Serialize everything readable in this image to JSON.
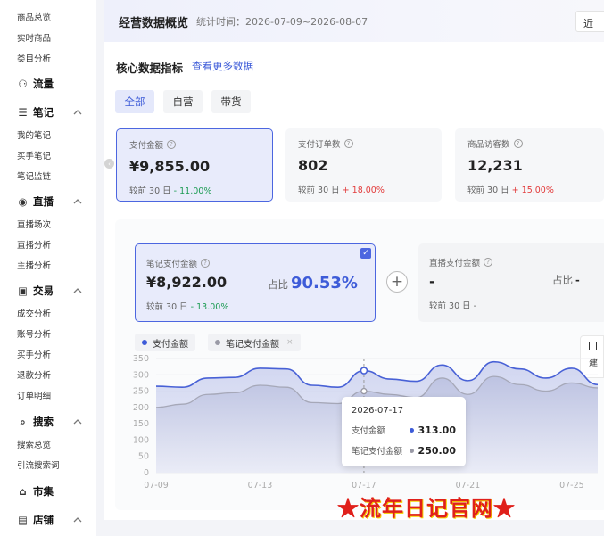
{
  "sidebar": {
    "items_top": [
      "商品总览",
      "实时商品",
      "类目分析"
    ],
    "groups": [
      {
        "label": "流量",
        "icon": "traffic-icon",
        "items": []
      },
      {
        "label": "笔记",
        "icon": "note-icon",
        "items": [
          "我的笔记",
          "买手笔记",
          "笔记监链"
        ]
      },
      {
        "label": "直播",
        "icon": "live-icon",
        "items": [
          "直播场次",
          "直播分析",
          "主播分析"
        ]
      },
      {
        "label": "交易",
        "icon": "trade-icon",
        "items": [
          "成交分析",
          "账号分析",
          "买手分析",
          "退款分析",
          "订单明细"
        ]
      },
      {
        "label": "搜索",
        "icon": "search-icon",
        "items": [
          "搜索总览",
          "引流搜索词"
        ]
      },
      {
        "label": "市集",
        "icon": "market-icon",
        "items": []
      },
      {
        "label": "店铺",
        "icon": "shop-icon",
        "items": []
      }
    ]
  },
  "header": {
    "title": "经营数据概览",
    "stat_time": "统计时间：2026-07-09~2026-08-07",
    "recent_label": "近"
  },
  "section": {
    "title": "核心数据指标",
    "more_link": "查看更多数据"
  },
  "tabs": [
    {
      "label": "全部",
      "active": true
    },
    {
      "label": "自营",
      "active": false
    },
    {
      "label": "带货",
      "active": false
    }
  ],
  "metrics": [
    {
      "label": "支付金额",
      "value": "¥9,855.00",
      "compare_prefix": "较前 30 日",
      "change": "- 11.00%",
      "trend": "down",
      "selected": true
    },
    {
      "label": "支付订单数",
      "value": "802",
      "compare_prefix": "较前 30 日",
      "change": "+ 18.00%",
      "trend": "up",
      "selected": false
    },
    {
      "label": "商品访客数",
      "value": "12,231",
      "compare_prefix": "较前 30 日",
      "change": "+ 15.00%",
      "trend": "up",
      "selected": false
    }
  ],
  "sub_metrics": [
    {
      "label": "笔记支付金额",
      "value": "¥8,922.00",
      "share_label": "占比",
      "share": "90.53%",
      "compare_prefix": "较前 30 日",
      "change": "- 13.00%"
    },
    {
      "label": "直播支付金额",
      "value": "-",
      "share_label": "占比",
      "share": "-",
      "compare_prefix": "较前 30 日",
      "change": "-"
    }
  ],
  "legend": [
    {
      "name": "支付金额",
      "color": "#3d5bd8"
    },
    {
      "name": "笔记支付金额",
      "color": "#9a9aa6",
      "close": "×"
    }
  ],
  "side_tool_label": "建",
  "tooltip": {
    "date": "2026-07-17",
    "rows": [
      {
        "name": "支付金额",
        "value": "313.00",
        "color": "#3d5bd8"
      },
      {
        "name": "笔记支付金额",
        "value": "250.00",
        "color": "#9a9aa6"
      }
    ]
  },
  "watermark": {
    "star": "★",
    "text": "流年日记官网"
  },
  "chart_data": {
    "type": "area",
    "x": [
      "07-09",
      "07-10",
      "07-11",
      "07-12",
      "07-13",
      "07-14",
      "07-15",
      "07-16",
      "07-17",
      "07-18",
      "07-19",
      "07-20",
      "07-21",
      "07-22",
      "07-23",
      "07-24",
      "07-25",
      "07-26"
    ],
    "x_tick_labels": [
      "07-09",
      "07-13",
      "07-17",
      "07-21",
      "07-25"
    ],
    "series": [
      {
        "name": "支付金额",
        "values": [
          265,
          262,
          290,
          292,
          320,
          318,
          268,
          262,
          313,
          287,
          280,
          330,
          282,
          340,
          318,
          290,
          320,
          270
        ]
      },
      {
        "name": "笔记支付金额",
        "values": [
          200,
          210,
          240,
          245,
          268,
          262,
          215,
          212,
          250,
          240,
          230,
          290,
          240,
          295,
          270,
          250,
          275,
          260
        ]
      }
    ],
    "ylim": [
      0,
      350
    ],
    "y_ticks": [
      0,
      50,
      100,
      150,
      200,
      250,
      300,
      350
    ],
    "highlight_x": "07-17"
  }
}
